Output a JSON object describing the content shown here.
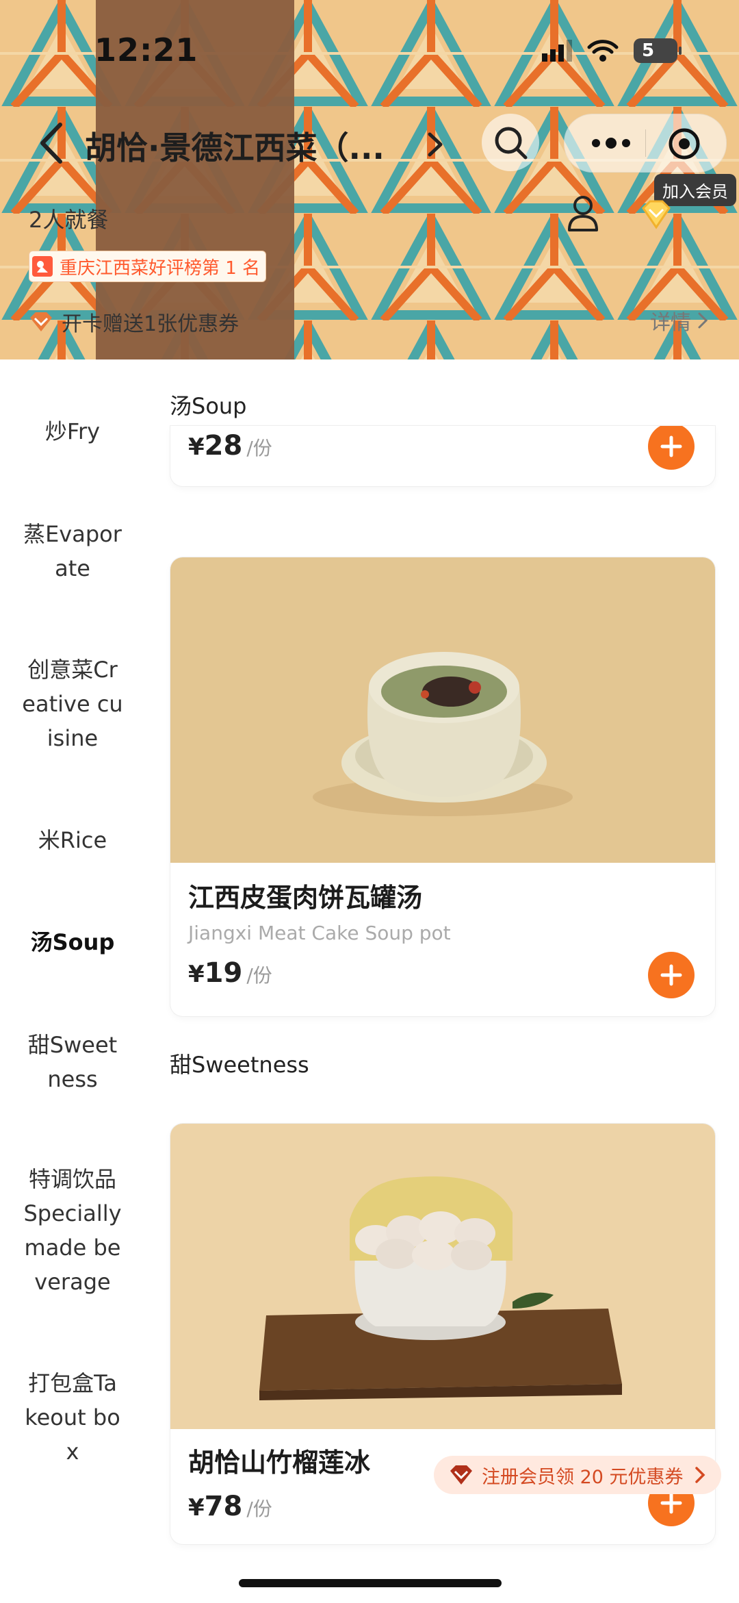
{
  "status_bar": {
    "time": "12:21",
    "battery": "57",
    "battery_show": "5"
  },
  "header": {
    "title": "胡恰·景德江西菜（...",
    "join_member": "加入会员",
    "dining": "2人就餐",
    "rank_badge": "重庆江西菜好评榜第 1 名",
    "card_promo": "开卡赠送1张优惠券",
    "details": "详情"
  },
  "sidebar": {
    "items": [
      {
        "lines": [
          "炒Fry"
        ]
      },
      {
        "lines": [
          "蒸Evapor",
          "ate"
        ]
      },
      {
        "lines": [
          "创意菜Cr",
          "eative cu",
          "isine"
        ]
      },
      {
        "lines": [
          "米Rice"
        ]
      },
      {
        "lines": [
          "汤Soup"
        ],
        "active": true
      },
      {
        "lines": [
          "甜Sweet",
          "ness"
        ]
      },
      {
        "lines": [
          "特调饮品",
          "Specially",
          "made be",
          "verage"
        ]
      },
      {
        "lines": [
          "打包盒Ta",
          "keout bo",
          "x"
        ]
      }
    ]
  },
  "content": {
    "sticky_section": "汤Soup",
    "partial_card": {
      "currency": "¥",
      "price": "28",
      "unit": "/份"
    },
    "dishes": [
      {
        "name": "江西皮蛋肉饼瓦罐汤",
        "en": "Jiangxi Meat Cake Soup pot",
        "currency": "¥",
        "price": "19",
        "unit": "/份"
      },
      {
        "name": "胡恰山竹榴莲冰",
        "currency": "¥",
        "price": "78",
        "unit": "/份"
      }
    ],
    "section_sweet": "甜Sweetness"
  },
  "member_pill": "注册会员领 20 元优惠券",
  "colors": {
    "accent": "#f7721f",
    "rank": "#ff5a2e",
    "brown": "#8a5e3f"
  }
}
